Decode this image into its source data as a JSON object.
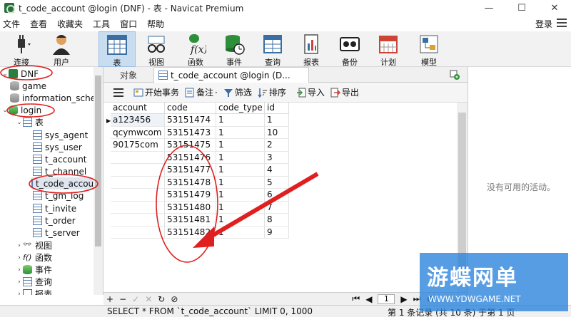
{
  "window": {
    "title": "t_code_account @login (DNF) - 表 - Navicat Premium",
    "controls": [
      "—",
      "☐",
      "✕"
    ]
  },
  "menu": {
    "items": [
      "文件",
      "查看",
      "收藏夹",
      "工具",
      "窗口",
      "帮助"
    ],
    "login": "登录"
  },
  "toolbar": {
    "buttons": [
      {
        "label": "连接",
        "icon": "plug-icon"
      },
      {
        "label": "用户",
        "icon": "user-icon"
      },
      {
        "label": "表",
        "icon": "table-icon",
        "active": true
      },
      {
        "label": "视图",
        "icon": "glasses-icon"
      },
      {
        "label": "函数",
        "icon": "function-icon"
      },
      {
        "label": "事件",
        "icon": "event-icon"
      },
      {
        "label": "查询",
        "icon": "query-icon"
      },
      {
        "label": "报表",
        "icon": "report-icon"
      },
      {
        "label": "备份",
        "icon": "backup-icon"
      },
      {
        "label": "计划",
        "icon": "calendar-icon"
      },
      {
        "label": "模型",
        "icon": "model-icon"
      }
    ]
  },
  "tree": {
    "connection": "DNF",
    "databases": [
      "game",
      "information_schema",
      "login"
    ],
    "tables_group": "表",
    "tables": [
      "sys_agent",
      "sys_user",
      "t_account",
      "t_channel",
      "t_code_account",
      "t_gm_log",
      "t_invite",
      "t_order",
      "t_server"
    ],
    "other_groups": [
      "视图",
      "函数",
      "事件",
      "查询",
      "报表"
    ]
  },
  "tabs": {
    "objects": "对象",
    "current": "t_code_account @login (D..."
  },
  "grid_toolbar": {
    "begin_transaction": "开始事务",
    "memo": "备注",
    "filter": "筛选",
    "sort": "排序",
    "import": "导入",
    "export": "导出"
  },
  "table": {
    "columns": [
      "account",
      "code",
      "code_type",
      "id"
    ],
    "rows": [
      [
        "a123456",
        "53151474",
        "1",
        "1"
      ],
      [
        "qcymwcom",
        "53151473",
        "1",
        "10"
      ],
      [
        "90175com",
        "53151475",
        "1",
        "2"
      ],
      [
        "",
        "53151476",
        "1",
        "3"
      ],
      [
        "",
        "53151477",
        "1",
        "4"
      ],
      [
        "",
        "53151478",
        "1",
        "5"
      ],
      [
        "",
        "53151479",
        "1",
        "6"
      ],
      [
        "",
        "53151480",
        "1",
        "7"
      ],
      [
        "",
        "53151481",
        "1",
        "8"
      ],
      [
        "",
        "53151482",
        "1",
        "9"
      ]
    ]
  },
  "nav": {
    "page": "1"
  },
  "status": {
    "sql": "SELECT * FROM `t_code_account` LIMIT 0, 1000",
    "record_info": "第 1 条记录 (共 10 条) 于第 1 页"
  },
  "right_panel": {
    "no_activity": "没有可用的活动。"
  },
  "watermark": {
    "title": "游蝶网单",
    "url": "WWW.YDWGAME.NET"
  },
  "colors": {
    "annotation_red": "#e02020",
    "toolbar_active": "#c8ddf0",
    "watermark_blue": "#2a88dc"
  }
}
